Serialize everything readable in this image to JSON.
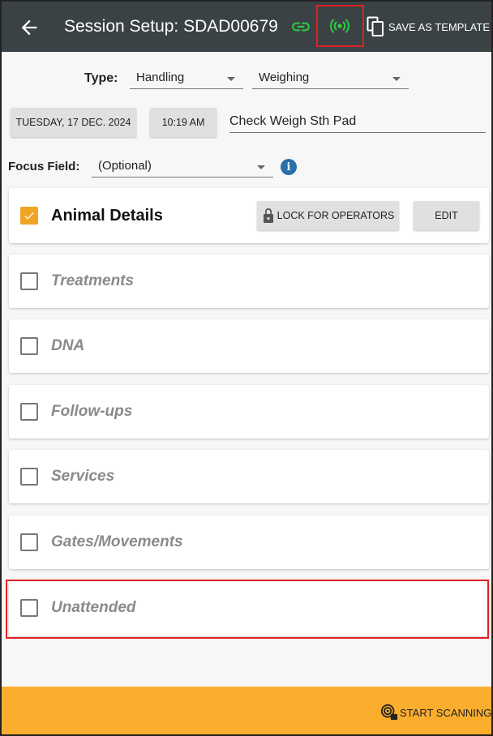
{
  "header": {
    "title": "Session Setup: SDAD00679",
    "save_template_label": "SAVE AS TEMPLATE",
    "icons": [
      "back-arrow-icon",
      "link-icon",
      "radio-signal-icon",
      "copy-icon"
    ],
    "link_color": "#2ecc40",
    "signal_color": "#2ecc40"
  },
  "form": {
    "type_label": "Type:",
    "type_primary": "Handling",
    "type_secondary": "Weighing",
    "date_button": "TUESDAY, 17 DEC. 2024",
    "time_button": "10:19 AM",
    "session_name": "Check Weigh Sth Pad",
    "focus_label": "Focus Field:",
    "focus_value": "(Optional)",
    "info_glyph": "i"
  },
  "sections": {
    "animal_details": {
      "label": "Animal Details",
      "checked": true,
      "lock_label": "LOCK FOR OPERATORS",
      "edit_label": "EDIT"
    },
    "items": [
      {
        "label": "Treatments",
        "checked": false
      },
      {
        "label": "DNA",
        "checked": false
      },
      {
        "label": "Follow-ups",
        "checked": false
      },
      {
        "label": "Services",
        "checked": false
      },
      {
        "label": "Gates/Movements",
        "checked": false
      },
      {
        "label": "Unattended",
        "checked": false
      }
    ]
  },
  "footer": {
    "start_scanning_label": "START SCANNING",
    "bar_color": "#fbae2e"
  },
  "colors": {
    "topbar": "#3a4245",
    "accent_checkbox": "#f0a324",
    "highlight": "#e02020",
    "info": "#2a6fa8"
  }
}
